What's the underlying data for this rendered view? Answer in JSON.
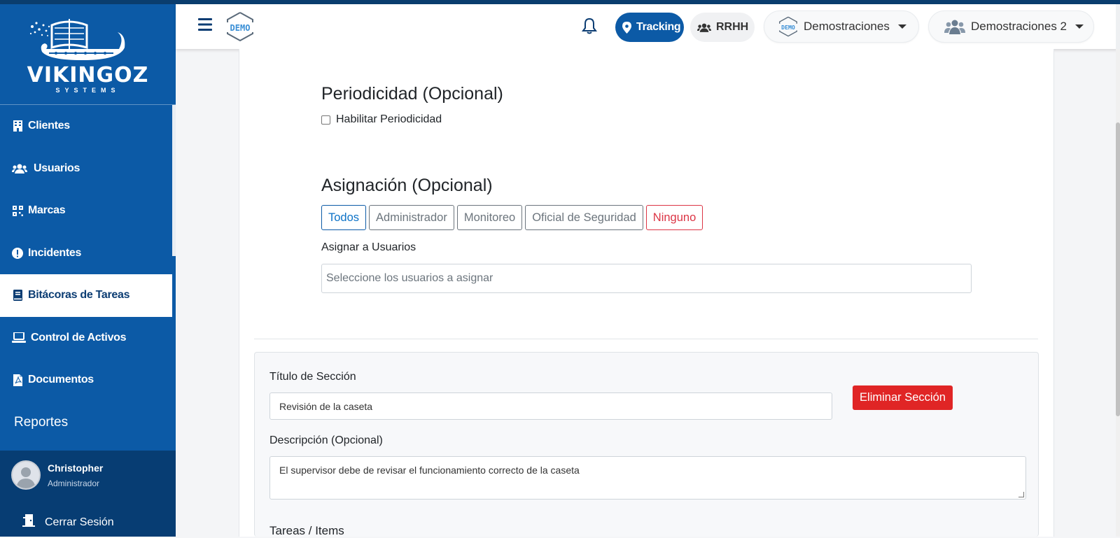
{
  "brand": {
    "name": "VIKINGOZ",
    "tagline": "SYSTEMS"
  },
  "sidebar": {
    "items": [
      {
        "label": "Clientes",
        "icon": "building-icon"
      },
      {
        "label": "Usuarios",
        "icon": "users-icon"
      },
      {
        "label": "Marcas",
        "icon": "qr-grid-icon"
      },
      {
        "label": "Incidentes",
        "icon": "alert-circle-icon"
      },
      {
        "label": "Bitácoras de Tareas",
        "icon": "book-icon",
        "active": true
      },
      {
        "label": "Control de Activos",
        "icon": "laptop-icon"
      },
      {
        "label": "Documentos",
        "icon": "pdf-file-icon"
      },
      {
        "label": "Reportes"
      }
    ],
    "user": {
      "name": "Christopher",
      "role": "Administrador"
    },
    "logout_label": "Cerrar Sesión"
  },
  "header": {
    "logo_text": "DEMO",
    "tracking_label": "Tracking",
    "rrhh_label": "RRHH",
    "company_select": "Demostraciones",
    "group_select": "Demostraciones 2"
  },
  "form": {
    "periodicity": {
      "title": "Periodicidad (Opcional)",
      "checkbox_label": "Habilitar Periodicidad",
      "checked": false
    },
    "assignment": {
      "title": "Asignación (Opcional)",
      "roles": [
        "Todos",
        "Administrador",
        "Monitoreo",
        "Oficial de Seguridad",
        "Ninguno"
      ],
      "users_label": "Asignar a Usuarios",
      "users_placeholder": "Seleccione los usuarios a asignar"
    },
    "section": {
      "title_label": "Título de Sección",
      "title_value": "Revisión de la caseta",
      "delete_label": "Eliminar Sección",
      "description_label": "Descripción (Opcional)",
      "description_value": "El supervisor debe de revisar el funcionamiento correcto de la caseta",
      "tasks_label": "Tareas / Items"
    }
  },
  "colors": {
    "primary": "#0c5aa6",
    "danger": "#e02525",
    "sidebar_dark": "#073d73"
  }
}
